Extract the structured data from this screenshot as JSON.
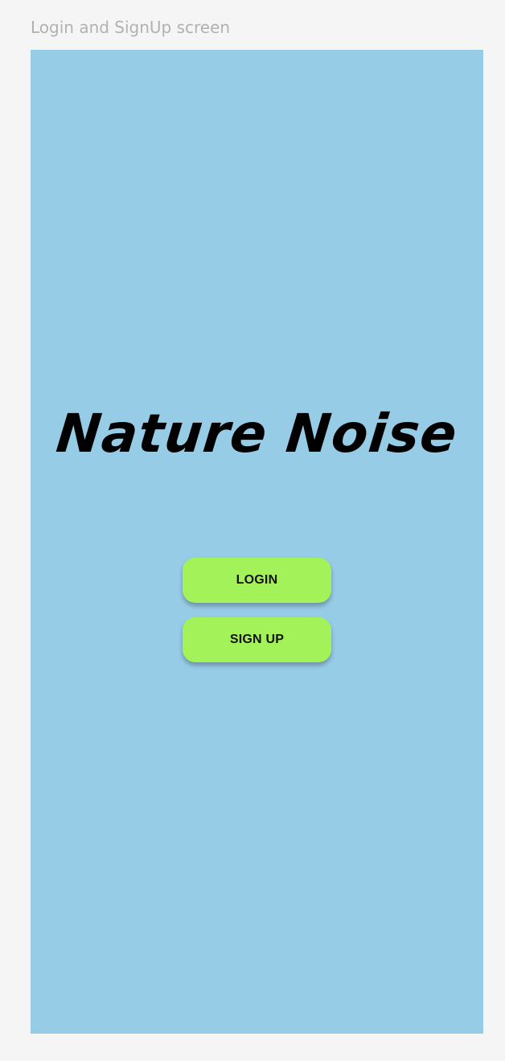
{
  "frame": {
    "label": "Login and SignUp screen",
    "background_color": "#97cce7"
  },
  "app": {
    "title": "Nature Noise"
  },
  "buttons": {
    "login_label": "LOGIN",
    "signup_label": "SIGN UP",
    "color": "#a4f25a"
  }
}
